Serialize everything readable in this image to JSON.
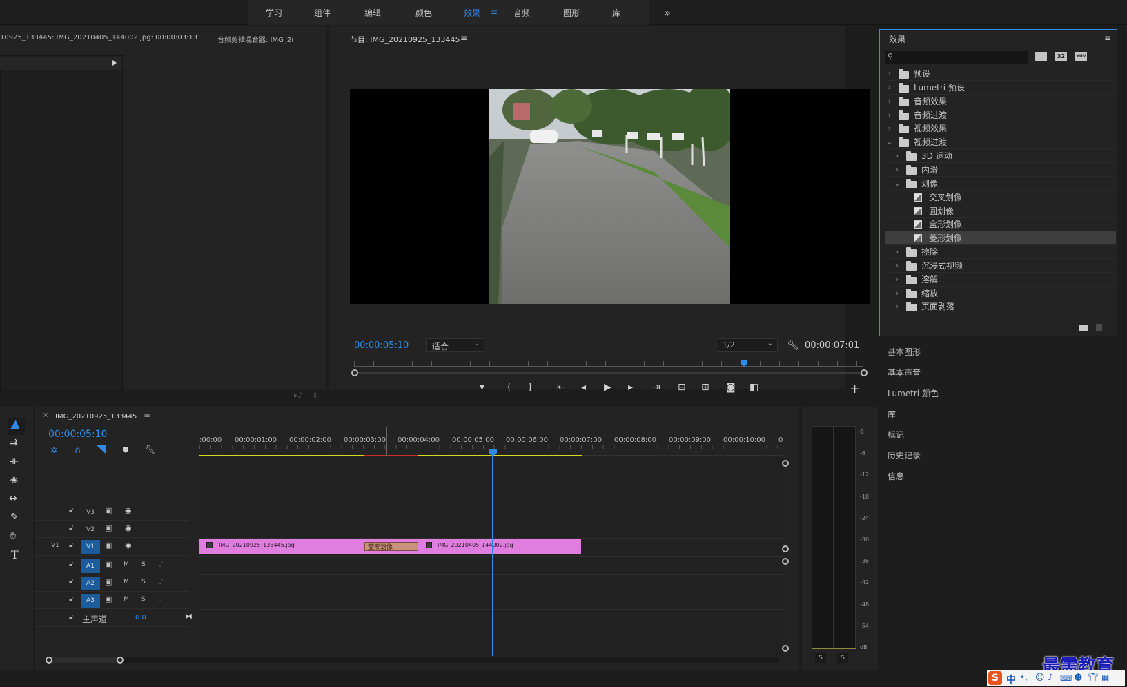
{
  "workspaces": {
    "items": [
      "学习",
      "组件",
      "编辑",
      "颜色",
      "效果",
      "音频",
      "图形",
      "库"
    ],
    "active_index": 4,
    "more": "»"
  },
  "source_panel": {
    "tab1": "10925_133445: IMG_20210405_144002.jpg: 00:00:03:13",
    "tab2": "音频剪辑混合器: IMG_2(",
    "more": "»"
  },
  "program": {
    "title": "节目: IMG_20210925_133445",
    "menu": "≡",
    "timecode_current": "00:00:05:10",
    "fit": "适合",
    "resolution": "1/2",
    "timecode_duration": "00:00:07:01",
    "add": "+"
  },
  "effects": {
    "title": "效果",
    "menu": "≡",
    "search_placeholder": "",
    "filter_32": "32",
    "filter_yuv": "YUV",
    "items": [
      {
        "label": "预设",
        "depth": 0,
        "expanded": false,
        "kind": "folder-star"
      },
      {
        "label": "Lumetri 预设",
        "depth": 0,
        "expanded": false,
        "kind": "folder-star"
      },
      {
        "label": "音频效果",
        "depth": 0,
        "expanded": false,
        "kind": "folder"
      },
      {
        "label": "音频过渡",
        "depth": 0,
        "expanded": false,
        "kind": "folder"
      },
      {
        "label": "视频效果",
        "depth": 0,
        "expanded": false,
        "kind": "folder"
      },
      {
        "label": "视频过渡",
        "depth": 0,
        "expanded": true,
        "kind": "folder"
      },
      {
        "label": "3D 运动",
        "depth": 1,
        "expanded": false,
        "kind": "folder"
      },
      {
        "label": "内滑",
        "depth": 1,
        "expanded": false,
        "kind": "folder"
      },
      {
        "label": "划像",
        "depth": 1,
        "expanded": true,
        "kind": "folder"
      },
      {
        "label": "交叉划像",
        "depth": 2,
        "kind": "effect"
      },
      {
        "label": "圆划像",
        "depth": 2,
        "kind": "effect"
      },
      {
        "label": "盒形划像",
        "depth": 2,
        "kind": "effect"
      },
      {
        "label": "菱形划像",
        "depth": 2,
        "kind": "effect",
        "selected": true
      },
      {
        "label": "擦除",
        "depth": 1,
        "expanded": false,
        "kind": "folder"
      },
      {
        "label": "沉浸式视频",
        "depth": 1,
        "expanded": false,
        "kind": "folder"
      },
      {
        "label": "溶解",
        "depth": 1,
        "expanded": false,
        "kind": "folder"
      },
      {
        "label": "缩放",
        "depth": 1,
        "expanded": false,
        "kind": "folder"
      },
      {
        "label": "页面剥落",
        "depth": 1,
        "expanded": false,
        "kind": "folder"
      }
    ]
  },
  "side_panels": [
    "基本图形",
    "基本声音",
    "Lumetri 颜色",
    "库",
    "标记",
    "历史记录",
    "信息"
  ],
  "timeline": {
    "close": "×",
    "title": "IMG_20210925_133445",
    "menu": "≡",
    "timecode": "00:00:05:10",
    "ruler": [
      ":00:00",
      "00:00:01:00",
      "00:00:02:00",
      "00:00:03:00",
      "00:00:04:00",
      "00:00:05:00",
      "00:00:06:00",
      "00:00:07:00",
      "00:00:08:00",
      "00:00:09:00",
      "00:00:10:00",
      "0"
    ],
    "tracks": [
      {
        "name": "V3",
        "source": "",
        "target": false
      },
      {
        "name": "V2",
        "source": "",
        "target": false
      },
      {
        "name": "V1",
        "source": "V1",
        "target": true
      },
      {
        "name": "A1",
        "source": "",
        "target": true,
        "audio": true
      },
      {
        "name": "A2",
        "source": "",
        "target": true,
        "audio": true
      },
      {
        "name": "A3",
        "source": "",
        "target": true,
        "audio": true
      }
    ],
    "master_label": "主声道",
    "master_value": "0.0",
    "clip1": "IMG_20210925_133445.jpg",
    "clip2": "IMG_20210405_144002.jpg",
    "transition": "菱形划像",
    "m_label": "M",
    "s_label": "S"
  },
  "meter": {
    "labels": [
      "0",
      "-6",
      "-12",
      "-18",
      "-24",
      "-30",
      "-36",
      "-42",
      "-48",
      "-54",
      "dB"
    ],
    "solo_left": "S",
    "solo_right": "S"
  },
  "watermark": "最需教育",
  "ime": {
    "lang": "中",
    "punct": "•,"
  },
  "colors": {
    "accent": "#2d8ceb",
    "clip": "#e07ee0",
    "transition": "#c9927a"
  }
}
